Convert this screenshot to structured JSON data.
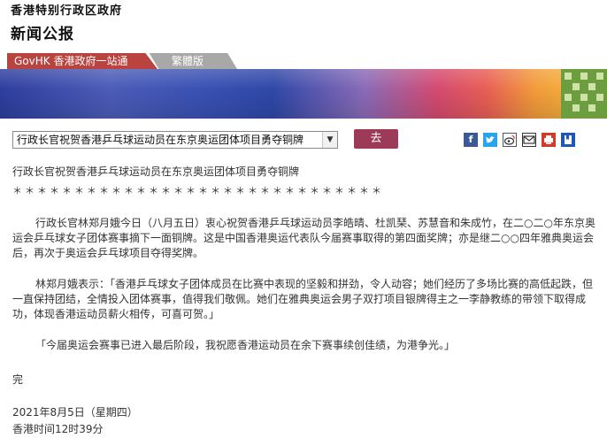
{
  "header": {
    "gov_name": "香港特别行政区政府",
    "press_title": "新闻公报"
  },
  "nav": {
    "govhk_label": "GovHK 香港政府一站通",
    "traditional_label": "繁體版"
  },
  "controls": {
    "selected_article": "行政长官祝贺香港乒乓球运动员在东京奥运团体项目勇夺铜牌",
    "go_label": "去"
  },
  "share_icons": [
    "facebook-icon",
    "twitter-icon",
    "weibo-icon",
    "email-icon",
    "print-icon",
    "bookmark-icon"
  ],
  "article": {
    "title": "行政长官祝贺香港乒乓球运动员在东京奥运团体项目勇夺铜牌",
    "stars": "＊＊＊＊＊＊＊＊＊＊＊＊＊＊＊＊＊＊＊＊＊＊＊＊＊＊＊＊＊＊",
    "para1": "行政长官林郑月娥今日（八月五日）衷心祝贺香港乒乓球运动员李皓晴、杜凯琹、苏慧音和朱成竹，在二○二○年东京奥运会乒乓球女子团体赛事摘下一面铜牌。这是中国香港奥运代表队今届赛事取得的第四面奖牌；亦是继二○○四年雅典奥运会后，再次于奥运会乒乓球项目夺得奖牌。",
    "para2": "林郑月娥表示：「香港乒乓球女子团体成员在比赛中表现的坚毅和拼劲，令人动容；她们经历了多场比赛的高低起跌，但一直保持团结，全情投入团体赛事，值得我们敬佩。她们在雅典奥运会男子双打项目银牌得主之一李静教练的带领下取得成功，体现香港运动员薪火相传，可喜可贺。」",
    "para3": "「今届奥运会赛事已进入最后阶段，我祝愿香港运动员在余下赛事续创佳绩，为港争光。」",
    "end": "完",
    "date": "2021年8月5日（星期四）",
    "time": "香港时间12时39分"
  },
  "colors": {
    "govhk_tab": "#b9433f",
    "traditional_tab": "#a8a8a8",
    "go_button": "#9c3a58",
    "banner_panel": "#6c9e3f"
  }
}
